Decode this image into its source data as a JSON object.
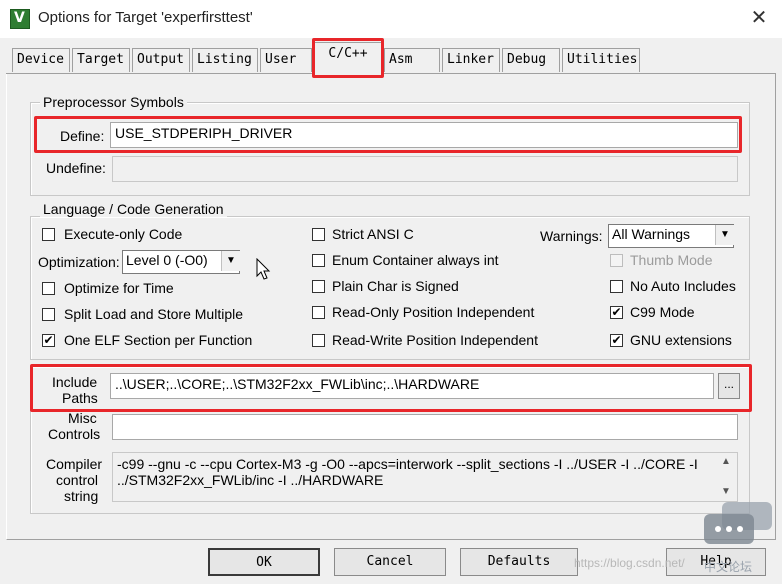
{
  "window": {
    "title": "Options for Target 'experfirsttest'",
    "close_label": "X"
  },
  "tabs": [
    "Device",
    "Target",
    "Output",
    "Listing",
    "User",
    "C/C++",
    "Asm",
    "Linker",
    "Debug",
    "Utilities"
  ],
  "active_tab": "C/C++",
  "preprocessor": {
    "legend": "Preprocessor Symbols",
    "define_label": "Define:",
    "define_value": "USE_STDPERIPH_DRIVER",
    "undefine_label": "Undefine:",
    "undefine_value": ""
  },
  "codegen": {
    "legend": "Language / Code Generation",
    "execute_only": {
      "label": "Execute-only Code",
      "checked": false
    },
    "optimization_label": "Optimization:",
    "optimization_value": "Level 0 (-O0)",
    "optimize_for_time": {
      "label": "Optimize for Time",
      "checked": false
    },
    "split_load_store": {
      "label": "Split Load and Store Multiple",
      "checked": false
    },
    "one_elf_section": {
      "label": "One ELF Section per Function",
      "checked": true
    },
    "strict_ansi_c": {
      "label": "Strict ANSI C",
      "checked": false
    },
    "enum_container": {
      "label": "Enum Container always int",
      "checked": false
    },
    "plain_char_signed": {
      "label": "Plain Char is Signed",
      "checked": false
    },
    "ropi": {
      "label": "Read-Only Position Independent",
      "checked": false
    },
    "rwpi": {
      "label": "Read-Write Position Independent",
      "checked": false
    },
    "warnings_label": "Warnings:",
    "warnings_value": "All Warnings",
    "thumb_mode": {
      "label": "Thumb Mode",
      "checked": false,
      "disabled": true
    },
    "no_auto_includes": {
      "label": "No Auto Includes",
      "checked": false
    },
    "c99_mode": {
      "label": "C99 Mode",
      "checked": true
    },
    "gnu_extensions": {
      "label": "GNU extensions",
      "checked": true
    }
  },
  "include": {
    "label_line1": "Include",
    "label_line2": "Paths",
    "value": "..\\USER;..\\CORE;..\\STM32F2xx_FWLib\\inc;..\\HARDWARE",
    "browse_label": "..."
  },
  "misc": {
    "label_line1": "Misc",
    "label_line2": "Controls",
    "value": ""
  },
  "compiler_string": {
    "label_line1": "Compiler",
    "label_line2": "control",
    "label_line3": "string",
    "line1": "-c99 --gnu -c --cpu Cortex-M3 -g -O0 --apcs=interwork --split_sections -I ../USER -I ../CORE -I",
    "line2": "../STM32F2xx_FWLib/inc -I ../HARDWARE"
  },
  "buttons": {
    "ok": "OK",
    "cancel": "Cancel",
    "defaults": "Defaults",
    "help": "Help"
  },
  "watermark": "https://blog.csdn.net/",
  "watermark_brand": "中文论坛",
  "colors": {
    "highlight": "#e8262a",
    "checkmark": "#000000"
  }
}
